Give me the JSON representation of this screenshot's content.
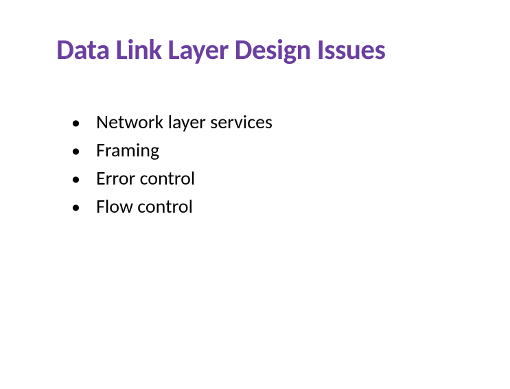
{
  "title": "Data Link Layer Design Issues",
  "bullets": {
    "0": "Network layer services",
    "1": "Framing",
    "2": "Error control",
    "3": "Flow control"
  }
}
